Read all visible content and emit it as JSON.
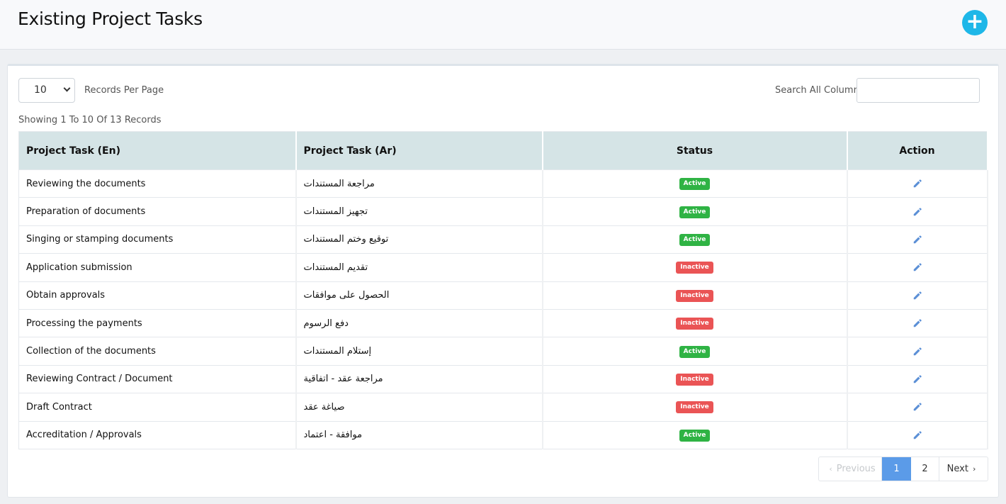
{
  "header": {
    "title": "Existing Project Tasks",
    "add_icon": "plus-circle-icon",
    "add_symbol": "+"
  },
  "controls": {
    "per_page_value": "10",
    "per_page_label": "Records Per Page",
    "search_label": "Search All Columns",
    "search_value": ""
  },
  "summary": "Showing 1 To 10 Of 13 Records",
  "table": {
    "columns": [
      "Project Task (En)",
      "Project Task (Ar)",
      "Status",
      "Action"
    ],
    "rows": [
      {
        "en": "Reviewing the documents",
        "ar": "مراجعة المستندات",
        "status": "Active"
      },
      {
        "en": "Preparation of documents",
        "ar": "تجهيز المستندات",
        "status": "Active"
      },
      {
        "en": "Singing or stamping documents",
        "ar": "توقيع وختم المستندات",
        "status": "Active"
      },
      {
        "en": "Application submission",
        "ar": "تقديم المستندات",
        "status": "Inactive"
      },
      {
        "en": "Obtain approvals",
        "ar": "الحصول على موافقات",
        "status": "Inactive"
      },
      {
        "en": "Processing the payments",
        "ar": "دفع الرسوم",
        "status": "Inactive"
      },
      {
        "en": "Collection of the documents",
        "ar": "إستلام المستندات",
        "status": "Active"
      },
      {
        "en": "Reviewing Contract / Document",
        "ar": "مراجعة عقد - اتفاقية",
        "status": "Inactive"
      },
      {
        "en": "Draft Contract",
        "ar": "صياغة عقد",
        "status": "Inactive"
      },
      {
        "en": "Accreditation / Approvals",
        "ar": "موافقة - اعتماد",
        "status": "Active"
      }
    ],
    "action_icon": "pencil-icon"
  },
  "pagination": {
    "previous": "Previous",
    "pages": [
      "1",
      "2"
    ],
    "current": "1",
    "next": "Next"
  },
  "colors": {
    "accent": "#1eb7e8",
    "active": "#2fb344",
    "inactive": "#ea5455",
    "current_page": "#5b9be8",
    "header_row": "#d5e4e6"
  }
}
